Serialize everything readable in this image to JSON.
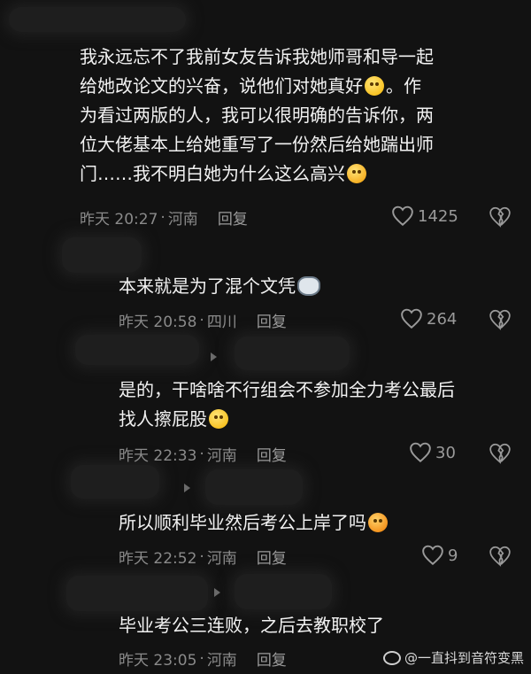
{
  "comments": [
    {
      "text_segments": [
        "我永远忘不了我前女友告诉我她师哥和导一起给她改论文的兴奋，说他们对她真好",
        "。作为看过两版的人，我可以很明确的告诉你，两位大佬基本上给她重写了一份然后给她踹出师门……我不明白她为什么这么高兴"
      ],
      "time": "昨天 20:27",
      "location": "河南",
      "reply": "回复",
      "likes": "1425"
    },
    {
      "text": "本来就是为了混个文凭",
      "time": "昨天 20:58",
      "location": "四川",
      "reply": "回复",
      "likes": "264"
    },
    {
      "text": "是的，干啥啥不行组会不参加全力考公最后找人擦屁股",
      "time": "昨天 22:33",
      "location": "河南",
      "reply": "回复",
      "likes": "30"
    },
    {
      "text": "所以顺利毕业然后考公上岸了吗",
      "time": "昨天 22:52",
      "location": "河南",
      "reply": "回复",
      "likes": "9"
    },
    {
      "text": "毕业考公三连败，之后去教职校了",
      "time": "昨天 23:05",
      "location": "河南",
      "reply": "回复"
    }
  ],
  "separator": "·",
  "watermark": "@一直抖到音符变黑",
  "colors": {
    "background": "#121212",
    "text": "#f2f2f2",
    "meta": "#8a8a8a"
  }
}
